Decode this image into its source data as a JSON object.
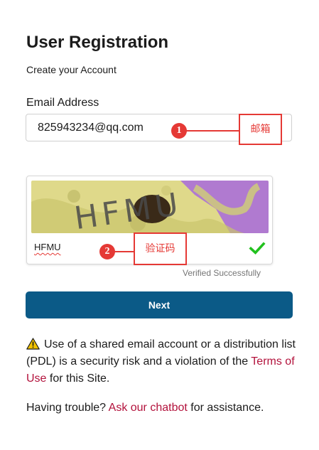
{
  "page": {
    "title": "User Registration",
    "subtitle": "Create your Account"
  },
  "email": {
    "label": "Email Address",
    "value": "825943234@qq.com"
  },
  "annotations": {
    "one": {
      "number": "1",
      "label": "邮箱"
    },
    "two": {
      "number": "2",
      "label": "验证码"
    },
    "color": "#e53935"
  },
  "captcha": {
    "image_text": "HFMU",
    "entered_text": "HFMU",
    "status_icon": "check-icon",
    "status_color": "#22c11e",
    "verified_text": "Verified Successfully"
  },
  "next_button": {
    "label": "Next",
    "color": "#0b5a87"
  },
  "warning": {
    "icon": "warning-icon",
    "text_before": "Use of a shared email account or a distribution list (PDL) is a security risk and a violation of the ",
    "link_text": "Terms of Use",
    "text_after": " for this Site."
  },
  "help": {
    "text_before": "Having trouble? ",
    "link_text": "Ask our chatbot",
    "text_after": " for assistance."
  },
  "colors": {
    "link": "#b3123c",
    "text": "#1b1b1b"
  }
}
